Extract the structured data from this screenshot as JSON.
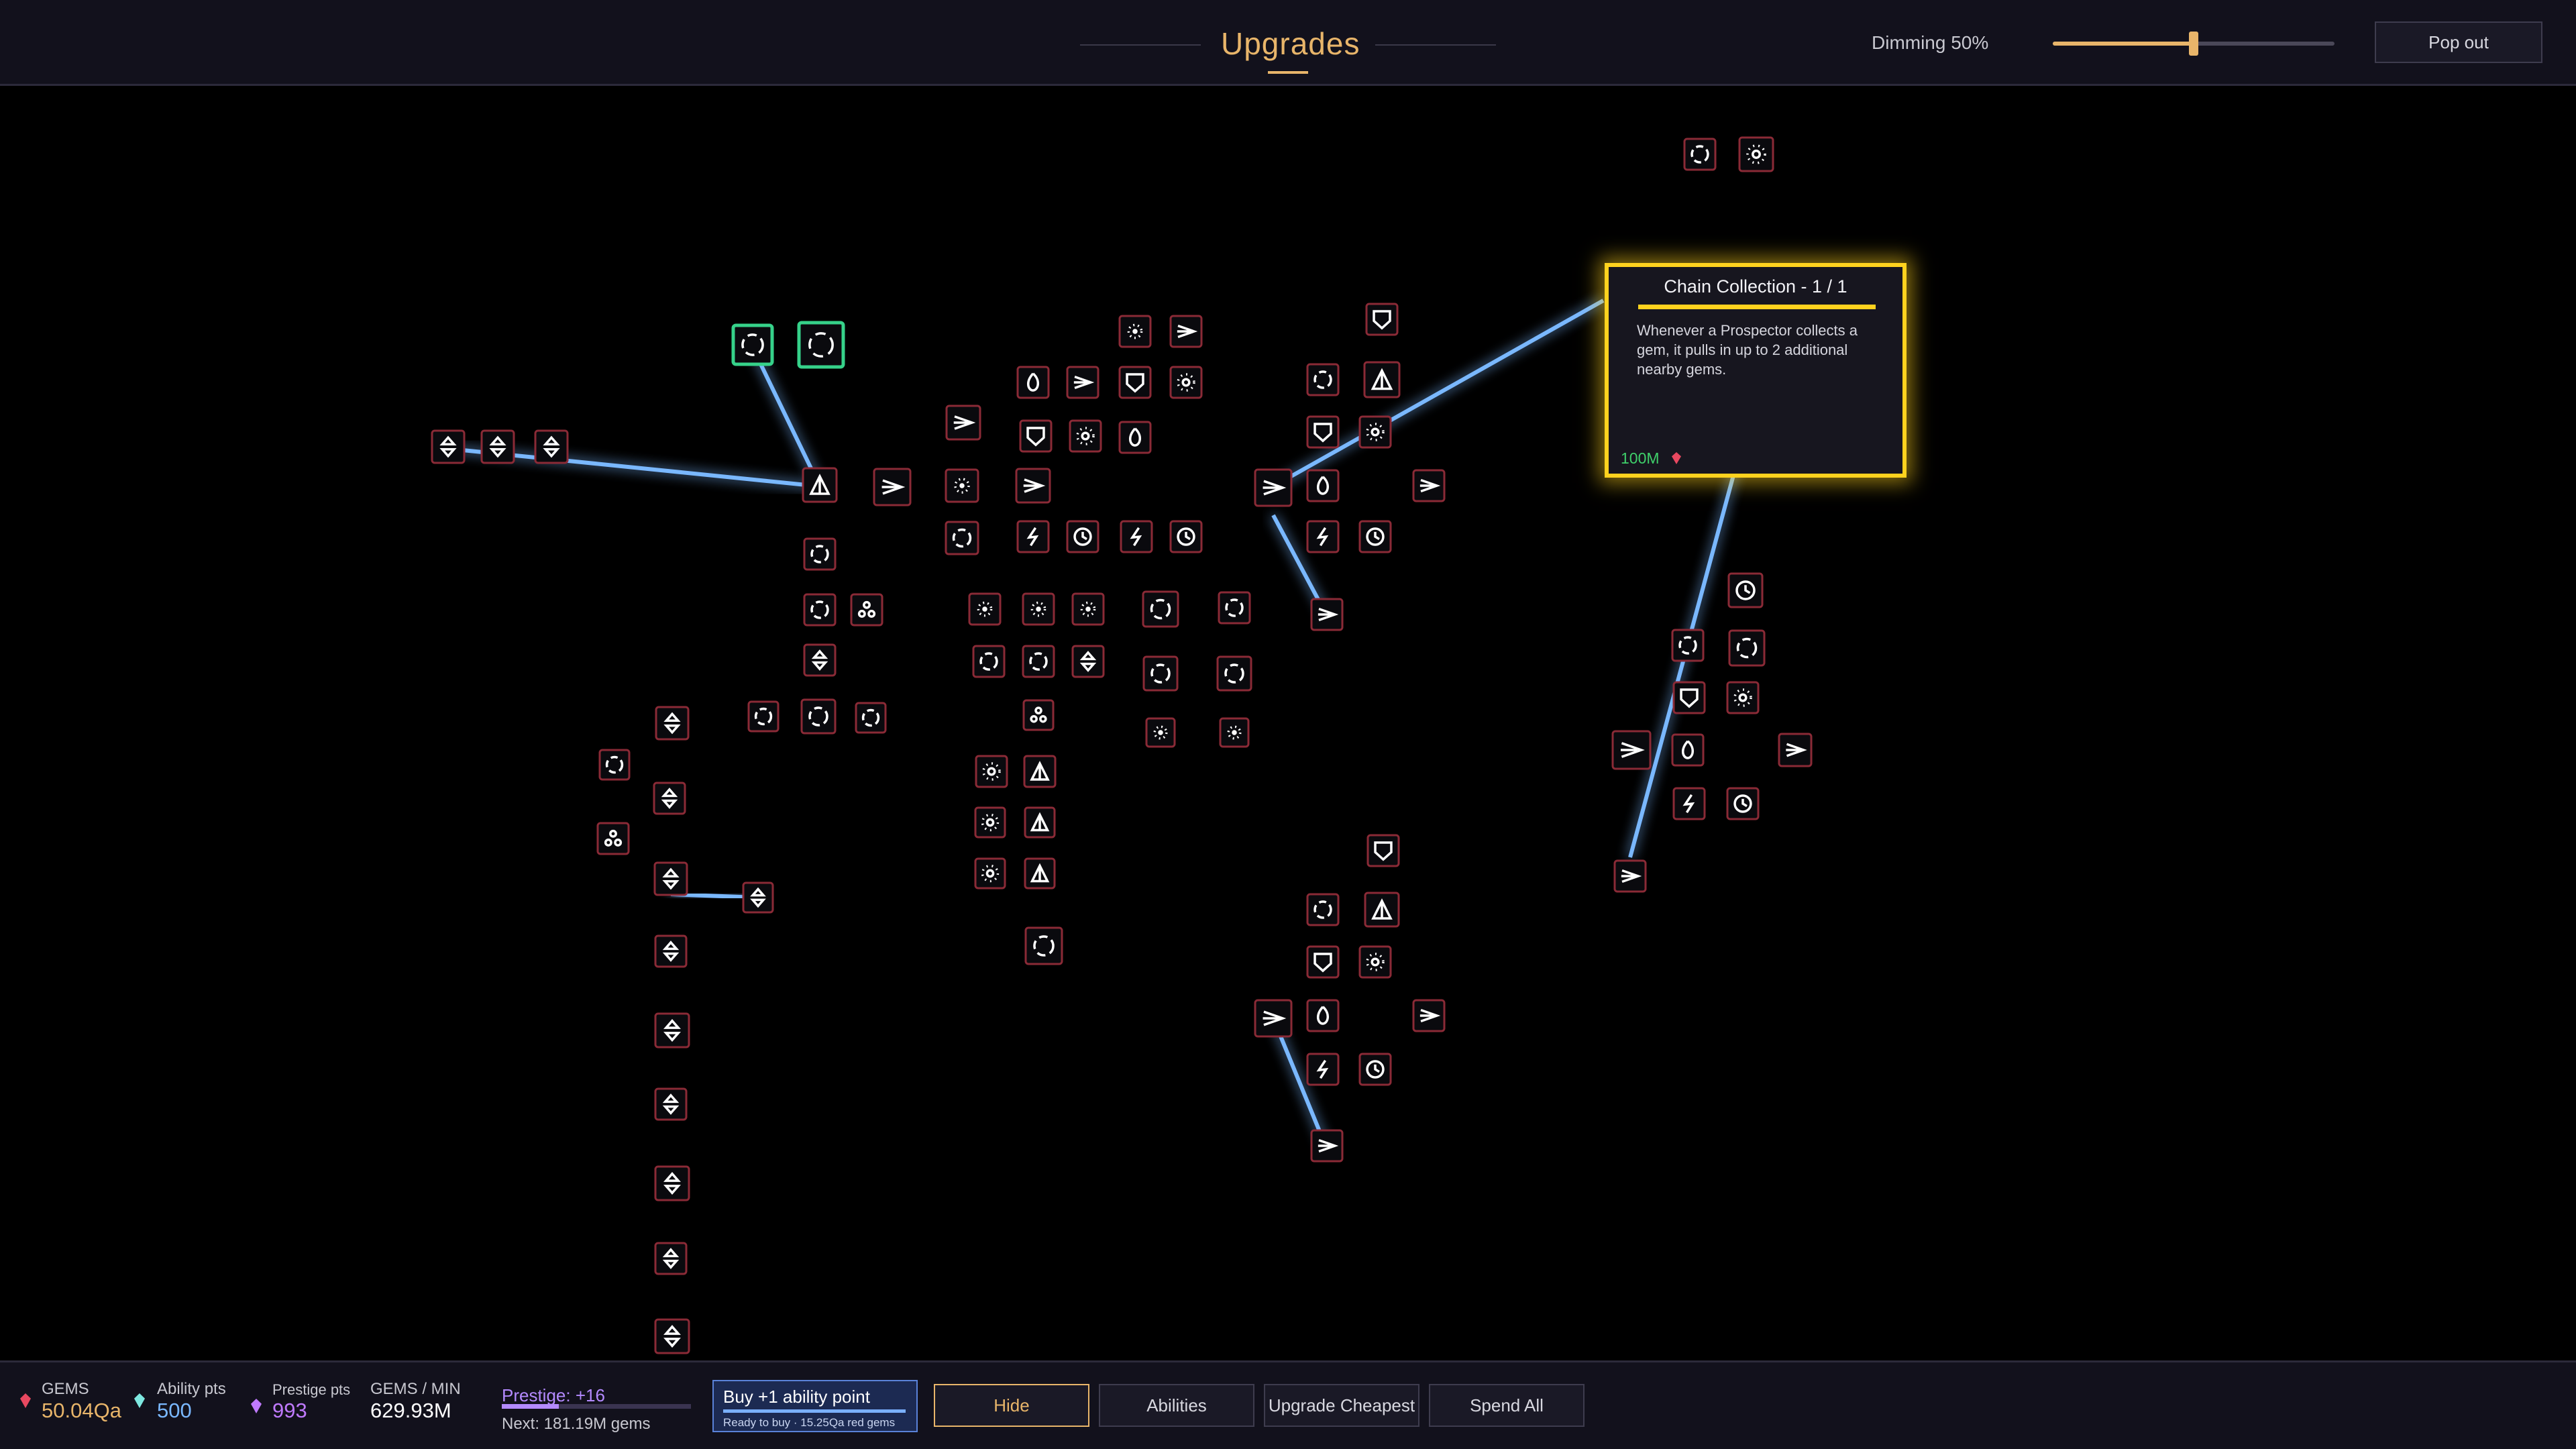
{
  "header": {
    "title": "Upgrades",
    "dimming_label": "Dimming 50%",
    "dimming_value": 0.5,
    "popout_label": "Pop out"
  },
  "tooltip": {
    "title": "Chain Collection - 1 / 1",
    "description": "Whenever a Prospector collects a gem, it pulls in up to 2 additional nearby gems.",
    "cost": "100M"
  },
  "stats": {
    "gems_label": "GEMS",
    "gems_value": "50.04Qa",
    "ability_label": "Ability pts",
    "ability_value": "500",
    "prestige_pts_label": "Prestige pts",
    "prestige_pts_value": "993",
    "gpm_label": "GEMS / MIN",
    "gpm_value": "629.93M"
  },
  "prestige": {
    "label": "Prestige: +16",
    "progress": 0.3,
    "next": "Next: 181.19M gems"
  },
  "buy_point": {
    "label": "Buy +1 ability point",
    "sub": "Ready to buy · 15.25Qa red gems"
  },
  "buttons": {
    "hide": "Hide",
    "abilities": "Abilities",
    "upgrade_cheapest": "Upgrade Cheapest",
    "spend_all": "Spend All"
  },
  "colors": {
    "accent": "#e8b56a",
    "tooltip_border": "#ffd21e",
    "prestige": "#b48aff",
    "cost": "#3fd06a",
    "link_glow": "#7ab8ff",
    "selected_node": "#36d28a"
  }
}
